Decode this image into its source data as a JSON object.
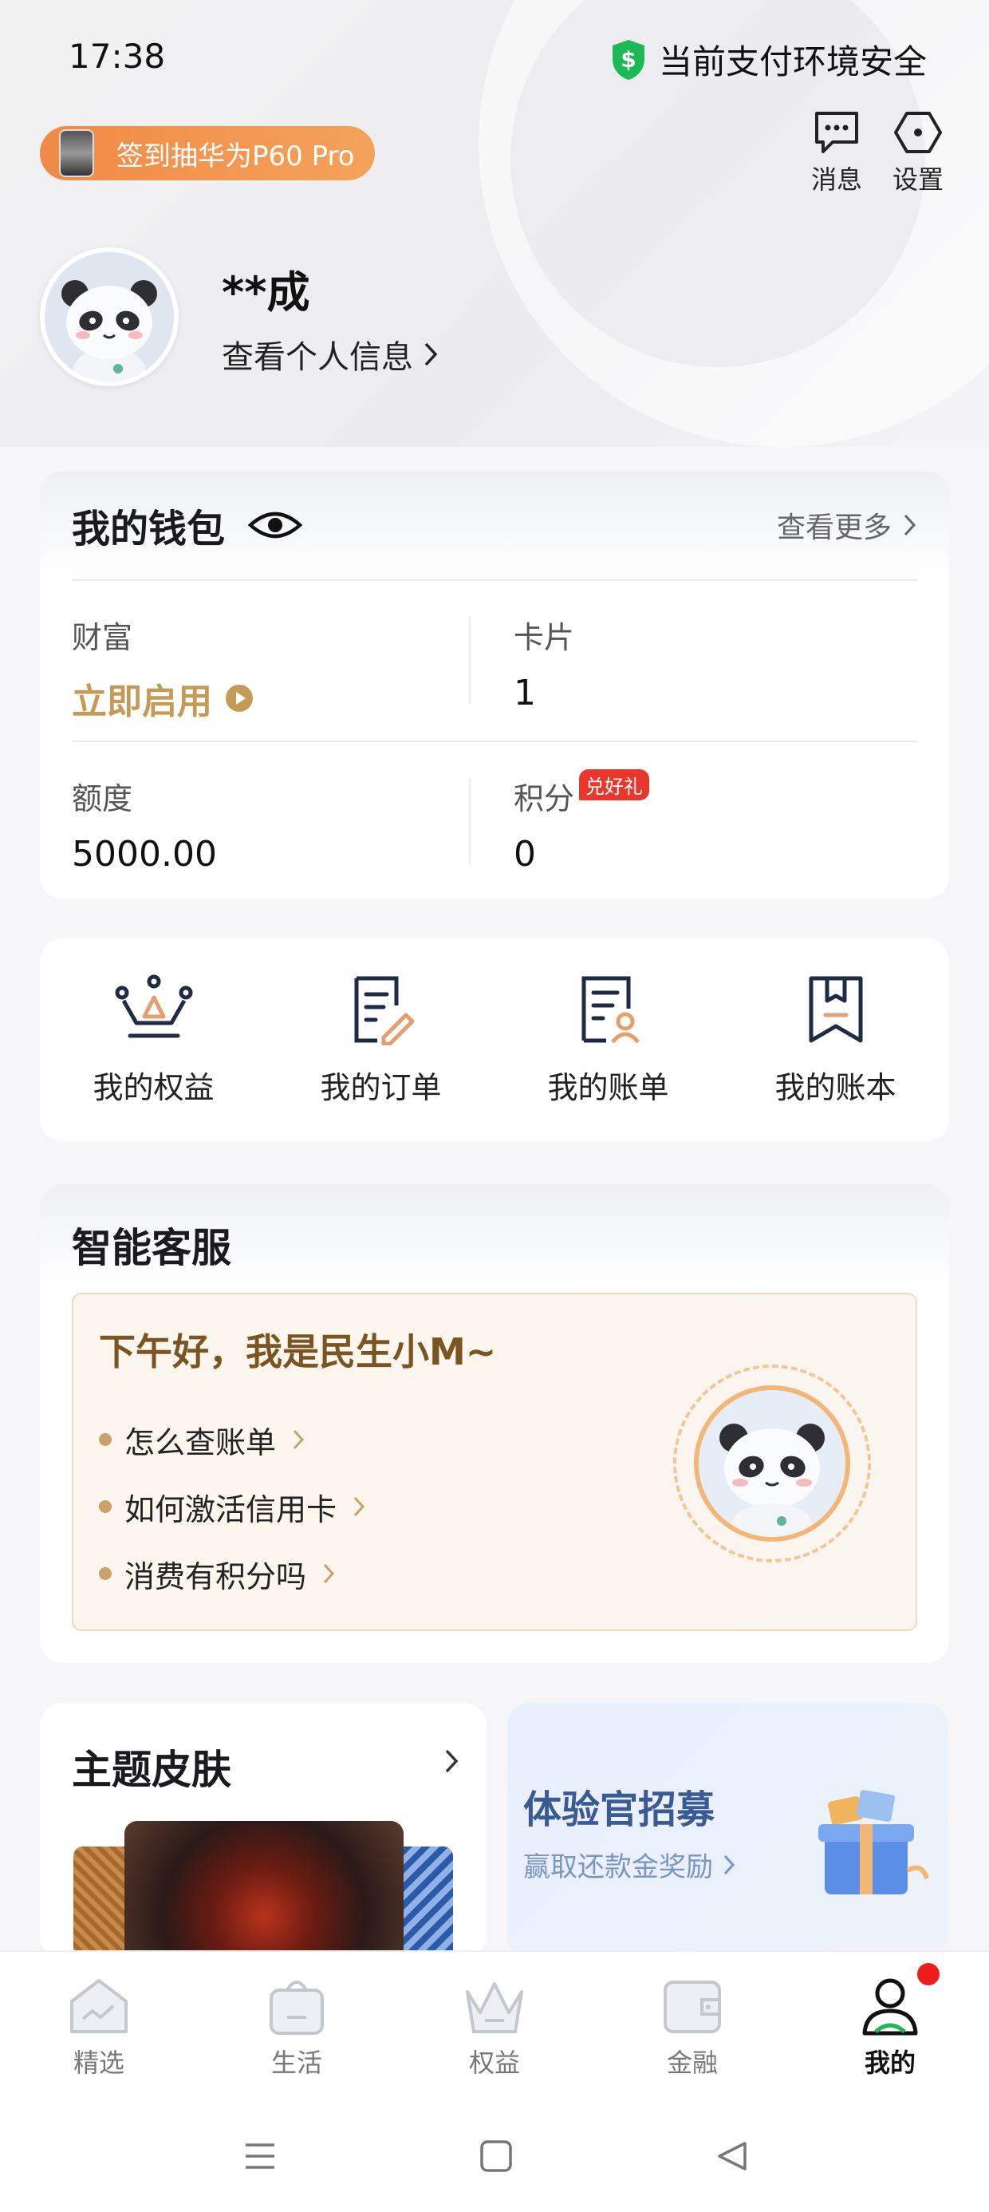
{
  "status_bar": {
    "time": "17:38",
    "security_text": "当前支付环境安全"
  },
  "header": {
    "signin_banner": "签到抽华为P60 Pro",
    "messages_label": "消息",
    "settings_label": "设置"
  },
  "profile": {
    "name": "**成",
    "view_info": "查看个人信息"
  },
  "wallet": {
    "title": "我的钱包",
    "see_more": "查看更多",
    "wealth_label": "财富",
    "wealth_value": "立即启用",
    "cards_label": "卡片",
    "cards_value": "1",
    "limit_label": "额度",
    "limit_value": "5000.00",
    "points_label": "积分",
    "points_badge": "兑好礼",
    "points_value": "0"
  },
  "quick_links": [
    {
      "label": "我的权益",
      "icon": "crown-icon"
    },
    {
      "label": "我的订单",
      "icon": "order-icon"
    },
    {
      "label": "我的账单",
      "icon": "bill-icon"
    },
    {
      "label": "我的账本",
      "icon": "ledger-icon"
    }
  ],
  "service": {
    "title": "智能客服",
    "greeting": "下午好，我是民生小M~",
    "questions": [
      "怎么查账单",
      "如何激活信用卡",
      "消费有积分吗"
    ]
  },
  "skin": {
    "title": "主题皮肤"
  },
  "recruit": {
    "title": "体验官招募",
    "subtitle": "赢取还款金奖励"
  },
  "tabs": [
    {
      "label": "精选",
      "icon": "home-icon"
    },
    {
      "label": "生活",
      "icon": "bag-icon"
    },
    {
      "label": "权益",
      "icon": "crown-tab-icon"
    },
    {
      "label": "金融",
      "icon": "wallet-icon"
    },
    {
      "label": "我的",
      "icon": "person-icon",
      "active": true
    }
  ],
  "colors": {
    "accent_gold": "#c59a56",
    "brand_orange": "#f08a46",
    "badge_red": "#e8382e",
    "safe_green": "#1db954"
  }
}
